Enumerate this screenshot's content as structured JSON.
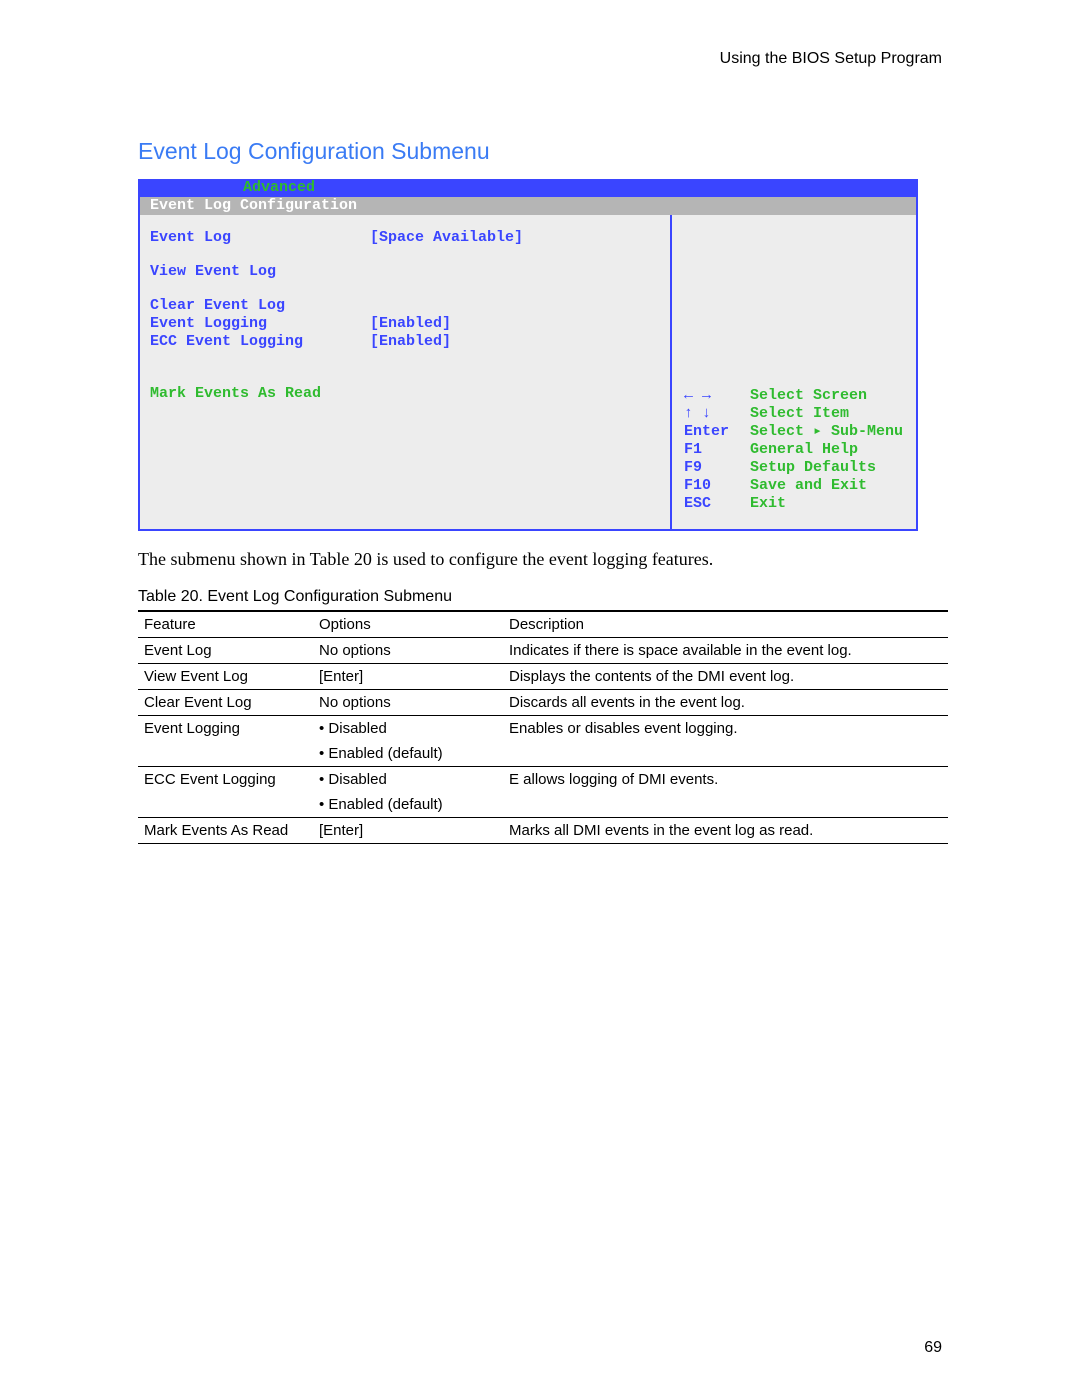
{
  "header": {
    "running": "Using the BIOS Setup Program"
  },
  "section": {
    "heading": "Event Log Configuration Submenu"
  },
  "bios": {
    "tabbar": {
      "active_tab": "Advanced"
    },
    "title": "Event Log Configuration",
    "left": {
      "event_log_label": "Event Log",
      "event_log_value": "[Space Available]",
      "view_label": "View Event Log",
      "clear_label": "Clear Event Log",
      "logging_label": "Event Logging",
      "logging_value": "[Enabled]",
      "ecc_label": "ECC Event Logging",
      "ecc_value": "[Enabled]",
      "mark_label": "Mark Events As Read"
    },
    "right": {
      "k1": "← →",
      "d1": "Select Screen",
      "k2": "↑ ↓",
      "d2": "Select Item",
      "k3": "Enter",
      "d3": "Select ▸ Sub-Menu",
      "k4": "F1",
      "d4": "General Help",
      "k5": "F9",
      "d5": "Setup Defaults",
      "k6": "F10",
      "d6": "Save and Exit",
      "k7": "ESC",
      "d7": "Exit"
    }
  },
  "para": {
    "text": "The submenu shown in Table 20 is used to configure the event logging features."
  },
  "table": {
    "caption": "Table 20.   Event Log Configuration Submenu",
    "head": {
      "c1": "Feature",
      "c2": "Options",
      "c3": "Description"
    },
    "rows": [
      {
        "f": "Event Log",
        "o": "No options",
        "d": "Indicates if there is space available in the event log."
      },
      {
        "f": "View Event Log",
        "o": "[Enter]",
        "d": "Displays the contents of the DMI event log."
      },
      {
        "f": "Clear Event Log",
        "o": "No options",
        "d": "Discards all events in the event log."
      },
      {
        "f": "Event Logging",
        "o": "•  Disabled",
        "d": "Enables or disables event logging."
      },
      {
        "f": "",
        "o": "•  Enabled (default)",
        "d": ""
      },
      {
        "f": "ECC Event Logging",
        "o": "•  Disabled",
        "d": "E          allows logging of DMI events."
      },
      {
        "f": "",
        "o": "•  Enabled (default)",
        "d": ""
      },
      {
        "f": "Mark Events As Read",
        "o": "[Enter]",
        "d": "Marks all DMI events in the event log as read."
      }
    ]
  },
  "footer": {
    "page_number": "69"
  }
}
